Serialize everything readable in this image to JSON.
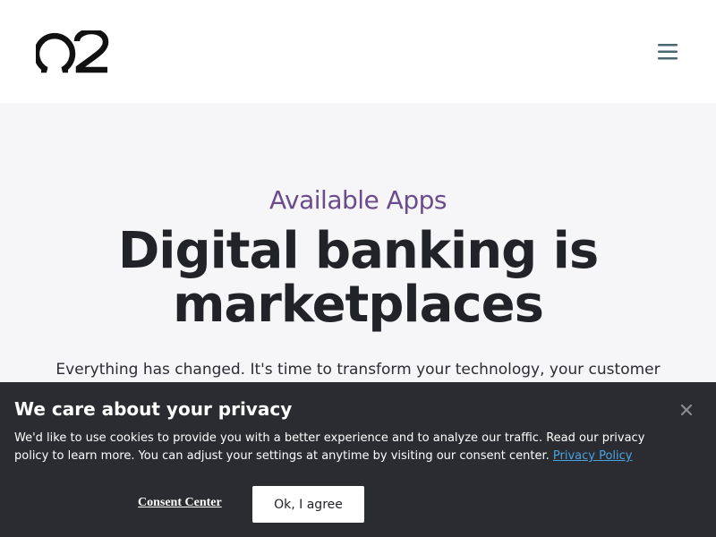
{
  "header": {
    "logo_text": "Q2",
    "menu_icon": "hamburger-menu-icon"
  },
  "hero": {
    "eyebrow": "Available Apps",
    "headline": "Digital banking is marketplaces",
    "intro": "Everything has changed. It's time to transform your technology, your customer"
  },
  "cookie_banner": {
    "title": "We care about your privacy",
    "text": "We'd like to use cookies to provide you with a better experience and to analyze our traffic. Read our privacy policy to learn more. You can adjust your settings at anytime by visiting our consent center.",
    "privacy_link": "Privacy Policy",
    "consent_center_label": "Consent Center",
    "agree_label": "Ok, I agree",
    "close_icon": "close-icon"
  },
  "colors": {
    "eyebrow": "#6a4c8c",
    "banner_bg": "#2b2c31",
    "link": "#4aa3df",
    "menu_icon": "#4a6670"
  }
}
